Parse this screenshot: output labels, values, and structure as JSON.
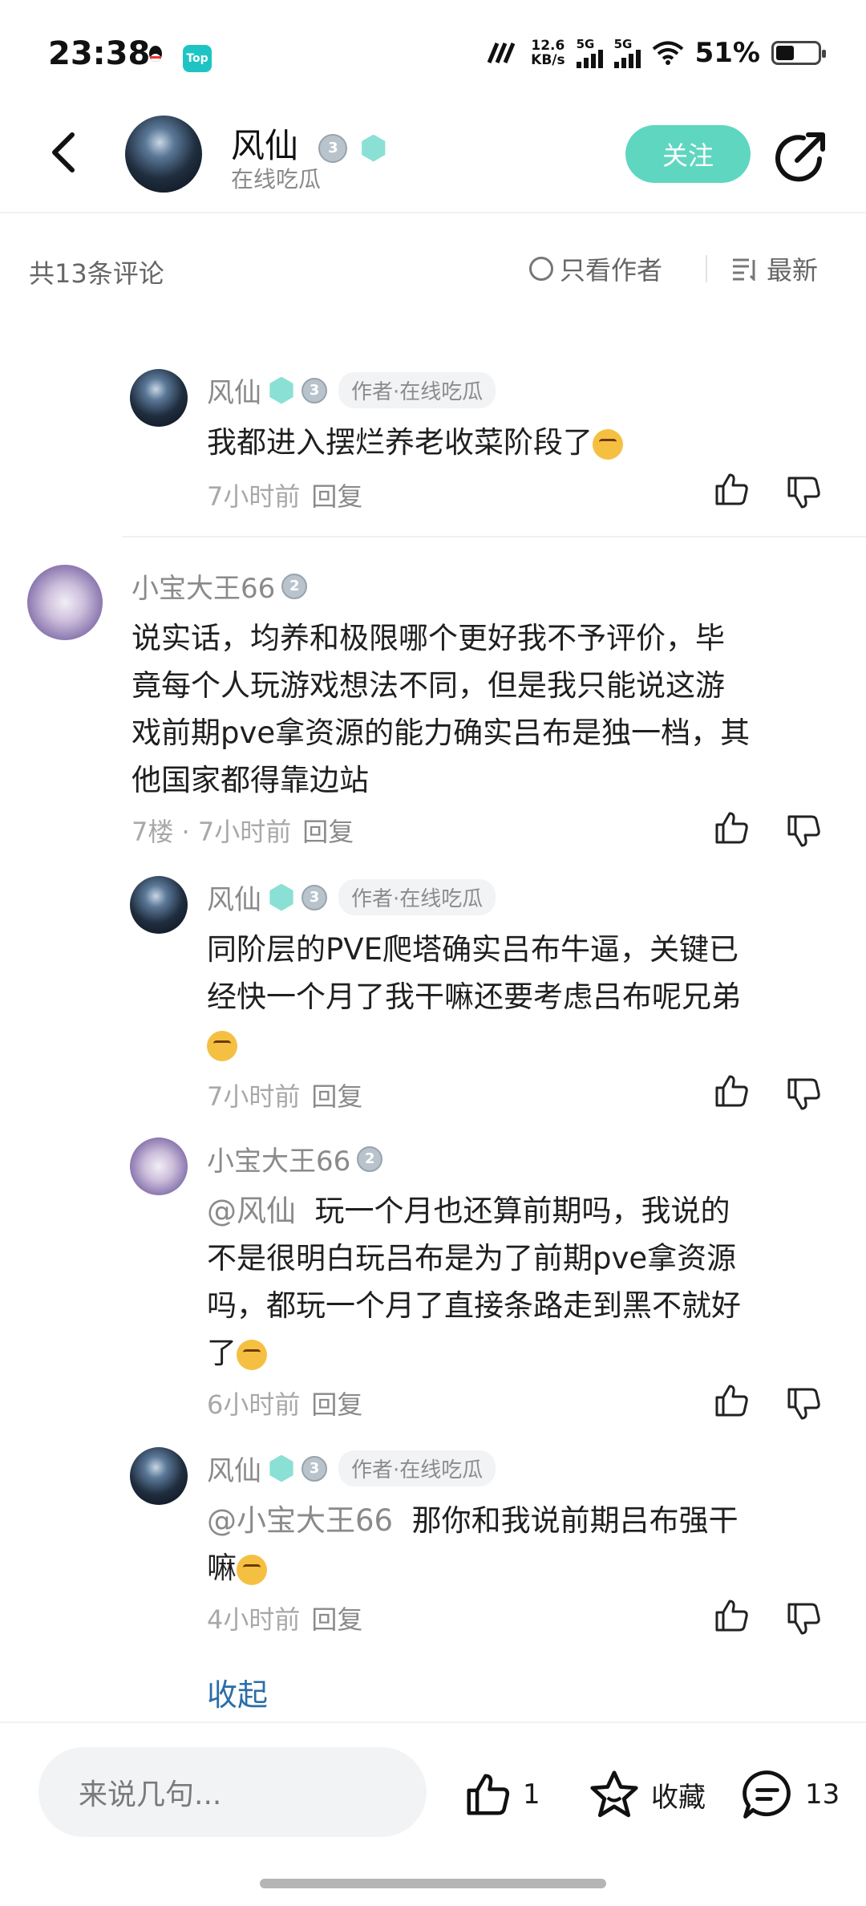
{
  "status": {
    "time": "23:38",
    "net_speed_value": "12.6",
    "net_speed_unit": "KB/s",
    "sim1": "5G",
    "sim2": "5G",
    "battery": "51%",
    "top_badge": "Top"
  },
  "header": {
    "author_name": "风仙",
    "author_badge": "3",
    "author_subtitle": "在线吃瓜",
    "follow_label": "关注"
  },
  "comments_header": {
    "count_label": "共13条评论",
    "only_author_label": "只看作者",
    "sort_label": "最新"
  },
  "comments": [
    {
      "user": "风仙",
      "badge": "3",
      "tag": "作者·在线吃瓜",
      "text": "我都进入摆烂养老收菜阶段了",
      "time": "7小时前",
      "reply_label": "回复"
    },
    {
      "user": "小宝大王66",
      "badge": "2",
      "text": "说实话，均养和极限哪个更好我不予评价，毕竟每个人玩游戏想法不同，但是我只能说这游戏前期pve拿资源的能力确实吕布是独一档，其他国家都得靠边站",
      "text_lines": [
        "说实话，均养和极限哪个更好我不予评价，毕",
        "竟每个人玩游戏想法不同，但是我只能说这游",
        "戏前期pve拿资源的能力确实吕布是独一档，其",
        "他国家都得靠边站"
      ],
      "floor": "7楼",
      "time": "7小时前",
      "reply_label": "回复"
    },
    {
      "user": "风仙",
      "badge": "3",
      "tag": "作者·在线吃瓜",
      "text_lines": [
        "同阶层的PVE爬塔确实吕布牛逼，关键已",
        "经快一个月了我干嘛还要考虑吕布呢兄弟"
      ],
      "time": "7小时前",
      "reply_label": "回复"
    },
    {
      "user": "小宝大王66",
      "badge": "2",
      "mention": "@风仙",
      "text_lines": [
        "玩一个月也还算前期吗，我说的",
        "不是很明白玩吕布是为了前期pve拿资源",
        "吗，都玩一个月了直接条路走到黑不就好",
        "了"
      ],
      "time": "6小时前",
      "reply_label": "回复"
    },
    {
      "user": "风仙",
      "badge": "3",
      "tag": "作者·在线吃瓜",
      "mention": "@小宝大王66",
      "text_lines": [
        "那你和我说前期吕布强干",
        "嘛"
      ],
      "time": "4小时前",
      "reply_label": "回复"
    }
  ],
  "collapse_label": "收起",
  "bottom_bar": {
    "input_placeholder": "来说几句...",
    "like_count": "1",
    "favorite_label": "收藏",
    "comment_count": "13"
  }
}
